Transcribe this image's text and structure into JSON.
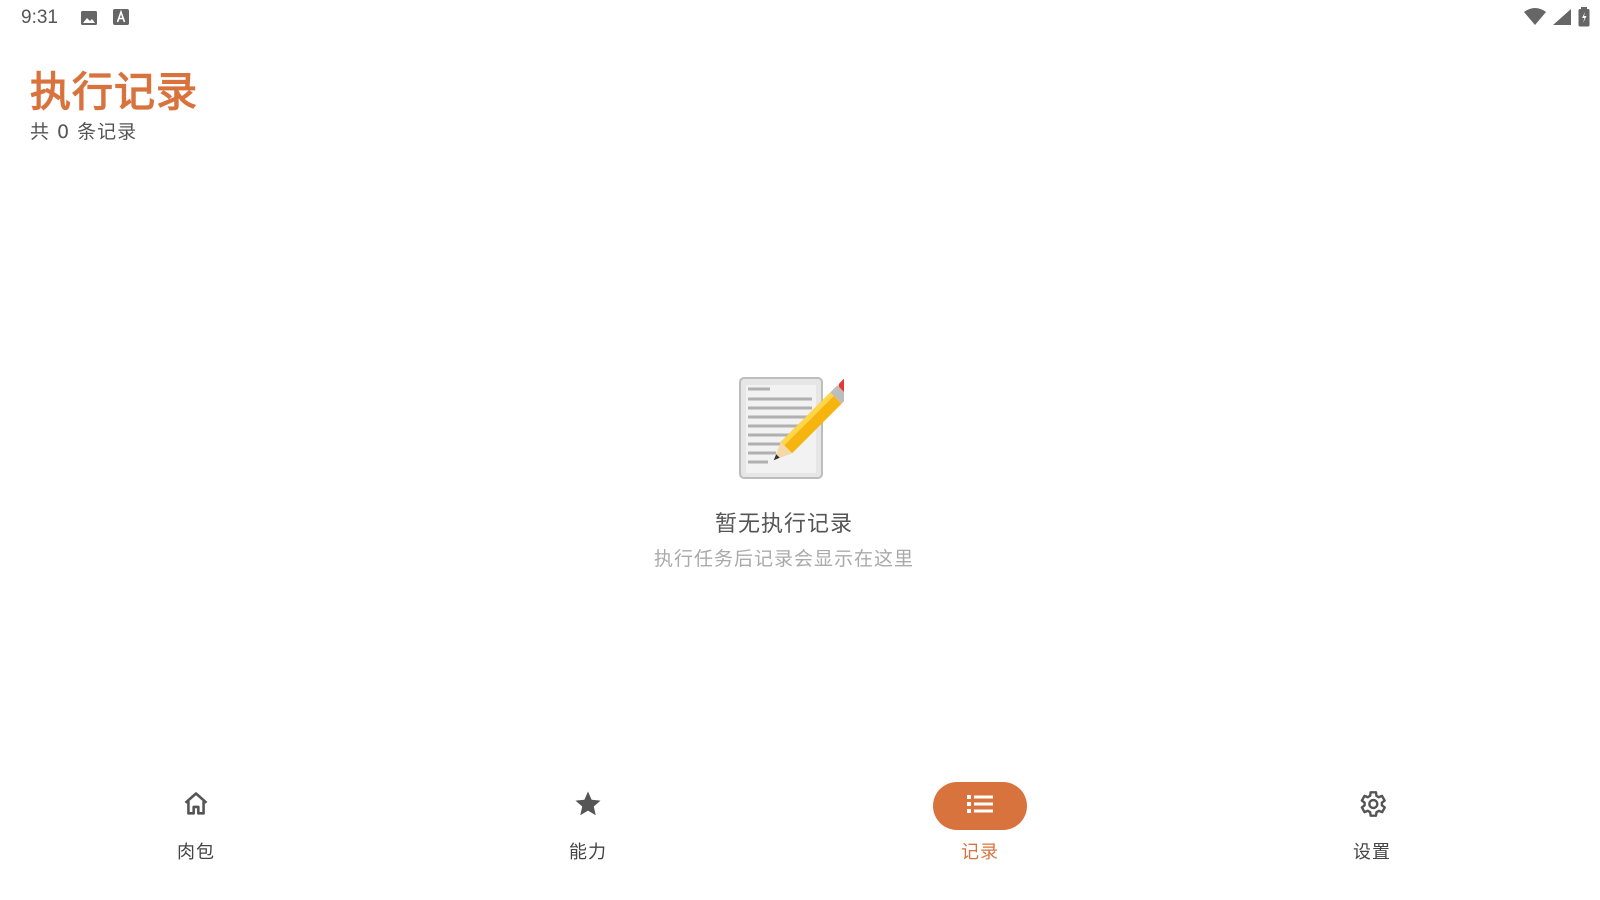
{
  "status_bar": {
    "time": "9:31",
    "icons_left": [
      "image-icon",
      "a-icon"
    ],
    "icons_right": [
      "wifi-icon",
      "signal-icon",
      "battery-icon"
    ]
  },
  "header": {
    "title": "执行记录",
    "subtitle": "共 0 条记录"
  },
  "empty_state": {
    "illustration": "memo-pencil-icon",
    "title": "暂无执行记录",
    "description": "执行任务后记录会显示在这里"
  },
  "bottom_nav": {
    "items": [
      {
        "label": "肉包",
        "icon": "home-icon",
        "active": false
      },
      {
        "label": "能力",
        "icon": "star-icon",
        "active": false
      },
      {
        "label": "记录",
        "icon": "list-icon",
        "active": true
      },
      {
        "label": "设置",
        "icon": "gear-icon",
        "active": false
      }
    ]
  },
  "colors": {
    "accent": "#D9733D",
    "text_primary": "#555555",
    "text_muted": "#AAAAAA",
    "background": "#FFFFFF"
  }
}
